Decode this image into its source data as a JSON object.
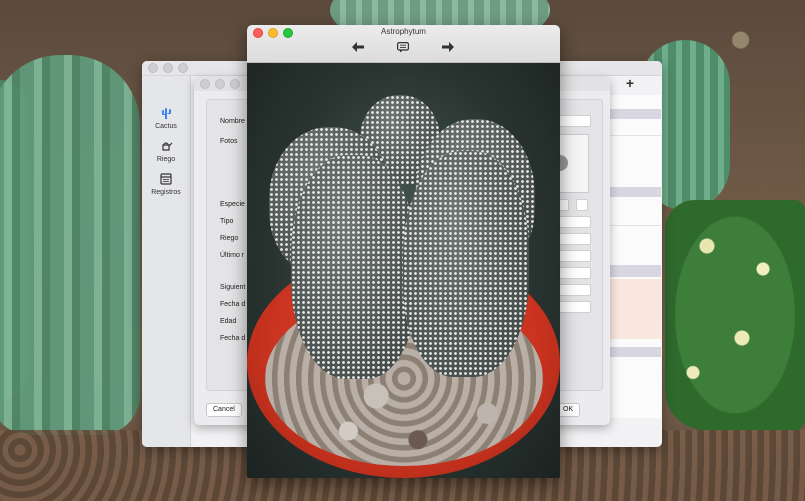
{
  "main_window": {
    "sidebar": {
      "items": [
        {
          "label": "Cactus",
          "icon": "cactus-icon",
          "active": true
        },
        {
          "label": "Riego",
          "icon": "watering-can-icon"
        },
        {
          "label": "Registros",
          "icon": "calendar-icon"
        }
      ]
    },
    "add_label": "+"
  },
  "sheet": {
    "fields": [
      {
        "label": "Nombre"
      },
      {
        "label": "Fotos"
      },
      {
        "label": "Especie"
      },
      {
        "label": "Tipo"
      },
      {
        "label": "Riego"
      },
      {
        "label": "Último r"
      },
      {
        "label": "Siguient"
      },
      {
        "label": "Fecha d"
      },
      {
        "label": "Edad"
      },
      {
        "label": "Fecha d"
      }
    ],
    "cancel_label": "Cancel",
    "ok_label": "OK"
  },
  "photo_window": {
    "title": "Astrophytum",
    "toolbar": {
      "back_icon": "arrow-left-icon",
      "comment_icon": "speech-bubble-icon",
      "forward_icon": "arrow-right-icon"
    }
  },
  "colors": {
    "accent": "#3b82f6",
    "close": "#fc5f57",
    "minimize": "#fdbc2e",
    "zoom": "#27c840",
    "pot": "#d63b25"
  }
}
